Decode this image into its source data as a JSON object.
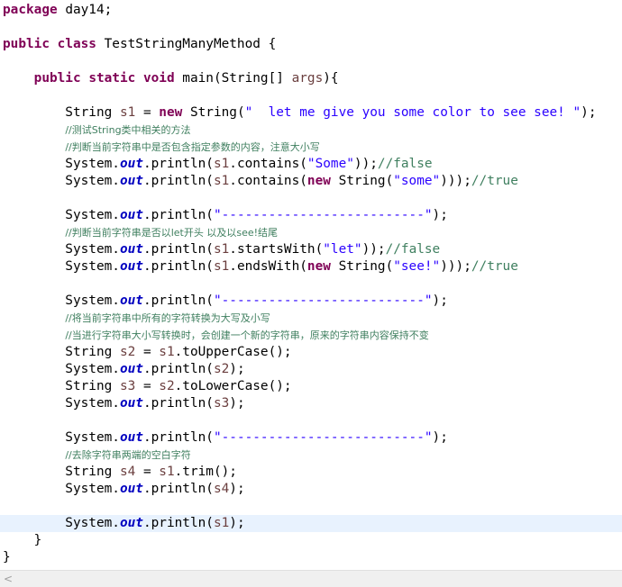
{
  "editor": {
    "current_line_index": 30,
    "colors": {
      "keyword": "#7f0055",
      "string": "#2a00ff",
      "comment": "#3f7f5f",
      "static_field": "#0000c0",
      "local_variable": "#6a3e3e",
      "current_line": "#e8f2fe"
    },
    "lines": [
      [
        {
          "t": "kw",
          "v": "package"
        },
        {
          "t": "pl",
          "v": " day14;"
        }
      ],
      [],
      [
        {
          "t": "kw",
          "v": "public"
        },
        {
          "t": "pl",
          "v": " "
        },
        {
          "t": "kw",
          "v": "class"
        },
        {
          "t": "pl",
          "v": " TestStringManyMethod {"
        }
      ],
      [],
      [
        {
          "t": "pl",
          "v": "    "
        },
        {
          "t": "kw",
          "v": "public"
        },
        {
          "t": "pl",
          "v": " "
        },
        {
          "t": "kw",
          "v": "static"
        },
        {
          "t": "pl",
          "v": " "
        },
        {
          "t": "kw",
          "v": "void"
        },
        {
          "t": "pl",
          "v": " main(String[] "
        },
        {
          "t": "loc",
          "v": "args"
        },
        {
          "t": "pl",
          "v": "){"
        }
      ],
      [],
      [
        {
          "t": "pl",
          "v": "        String "
        },
        {
          "t": "loc",
          "v": "s1"
        },
        {
          "t": "pl",
          "v": " = "
        },
        {
          "t": "kw",
          "v": "new"
        },
        {
          "t": "pl",
          "v": " String("
        },
        {
          "t": "str",
          "v": "\"  let me give you some color to see see! \""
        },
        {
          "t": "pl",
          "v": ");"
        }
      ],
      [
        {
          "t": "pl",
          "v": "        "
        },
        {
          "t": "cmt",
          "v": "//测试String类中相关的方法"
        }
      ],
      [
        {
          "t": "pl",
          "v": "        "
        },
        {
          "t": "cmt",
          "v": "//判断当前字符串中是否包含指定参数的内容，注意大小写"
        }
      ],
      [
        {
          "t": "pl",
          "v": "        System."
        },
        {
          "t": "fld",
          "v": "out"
        },
        {
          "t": "pl",
          "v": ".println("
        },
        {
          "t": "loc",
          "v": "s1"
        },
        {
          "t": "pl",
          "v": ".contains("
        },
        {
          "t": "str",
          "v": "\"Some\""
        },
        {
          "t": "pl",
          "v": "));"
        },
        {
          "t": "cmt",
          "v": "//false"
        }
      ],
      [
        {
          "t": "pl",
          "v": "        System."
        },
        {
          "t": "fld",
          "v": "out"
        },
        {
          "t": "pl",
          "v": ".println("
        },
        {
          "t": "loc",
          "v": "s1"
        },
        {
          "t": "pl",
          "v": ".contains("
        },
        {
          "t": "kw",
          "v": "new"
        },
        {
          "t": "pl",
          "v": " String("
        },
        {
          "t": "str",
          "v": "\"some\""
        },
        {
          "t": "pl",
          "v": ")));"
        },
        {
          "t": "cmt",
          "v": "//true"
        }
      ],
      [],
      [
        {
          "t": "pl",
          "v": "        System."
        },
        {
          "t": "fld",
          "v": "out"
        },
        {
          "t": "pl",
          "v": ".println("
        },
        {
          "t": "str",
          "v": "\"--------------------------\""
        },
        {
          "t": "pl",
          "v": ");"
        }
      ],
      [
        {
          "t": "pl",
          "v": "        "
        },
        {
          "t": "cmt",
          "v": "//判断当前字符串是否以let开头 以及以see!结尾"
        }
      ],
      [
        {
          "t": "pl",
          "v": "        System."
        },
        {
          "t": "fld",
          "v": "out"
        },
        {
          "t": "pl",
          "v": ".println("
        },
        {
          "t": "loc",
          "v": "s1"
        },
        {
          "t": "pl",
          "v": ".startsWith("
        },
        {
          "t": "str",
          "v": "\"let\""
        },
        {
          "t": "pl",
          "v": "));"
        },
        {
          "t": "cmt",
          "v": "//false"
        }
      ],
      [
        {
          "t": "pl",
          "v": "        System."
        },
        {
          "t": "fld",
          "v": "out"
        },
        {
          "t": "pl",
          "v": ".println("
        },
        {
          "t": "loc",
          "v": "s1"
        },
        {
          "t": "pl",
          "v": ".endsWith("
        },
        {
          "t": "kw",
          "v": "new"
        },
        {
          "t": "pl",
          "v": " String("
        },
        {
          "t": "str",
          "v": "\"see!\""
        },
        {
          "t": "pl",
          "v": ")));"
        },
        {
          "t": "cmt",
          "v": "//true"
        }
      ],
      [],
      [
        {
          "t": "pl",
          "v": "        System."
        },
        {
          "t": "fld",
          "v": "out"
        },
        {
          "t": "pl",
          "v": ".println("
        },
        {
          "t": "str",
          "v": "\"--------------------------\""
        },
        {
          "t": "pl",
          "v": ");"
        }
      ],
      [
        {
          "t": "pl",
          "v": "        "
        },
        {
          "t": "cmt",
          "v": "//将当前字符串中所有的字符转换为大写及小写"
        }
      ],
      [
        {
          "t": "pl",
          "v": "        "
        },
        {
          "t": "cmt",
          "v": "//当进行字符串大小写转换时，会创建一个新的字符串，原来的字符串内容保持不变"
        }
      ],
      [
        {
          "t": "pl",
          "v": "        String "
        },
        {
          "t": "loc",
          "v": "s2"
        },
        {
          "t": "pl",
          "v": " = "
        },
        {
          "t": "loc",
          "v": "s1"
        },
        {
          "t": "pl",
          "v": ".toUpperCase();"
        }
      ],
      [
        {
          "t": "pl",
          "v": "        System."
        },
        {
          "t": "fld",
          "v": "out"
        },
        {
          "t": "pl",
          "v": ".println("
        },
        {
          "t": "loc",
          "v": "s2"
        },
        {
          "t": "pl",
          "v": ");"
        }
      ],
      [
        {
          "t": "pl",
          "v": "        String "
        },
        {
          "t": "loc",
          "v": "s3"
        },
        {
          "t": "pl",
          "v": " = "
        },
        {
          "t": "loc",
          "v": "s2"
        },
        {
          "t": "pl",
          "v": ".toLowerCase();"
        }
      ],
      [
        {
          "t": "pl",
          "v": "        System."
        },
        {
          "t": "fld",
          "v": "out"
        },
        {
          "t": "pl",
          "v": ".println("
        },
        {
          "t": "loc",
          "v": "s3"
        },
        {
          "t": "pl",
          "v": ");"
        }
      ],
      [],
      [
        {
          "t": "pl",
          "v": "        System."
        },
        {
          "t": "fld",
          "v": "out"
        },
        {
          "t": "pl",
          "v": ".println("
        },
        {
          "t": "str",
          "v": "\"--------------------------\""
        },
        {
          "t": "pl",
          "v": ");"
        }
      ],
      [
        {
          "t": "pl",
          "v": "        "
        },
        {
          "t": "cmt",
          "v": "//去除字符串两端的空白字符"
        }
      ],
      [
        {
          "t": "pl",
          "v": "        String "
        },
        {
          "t": "loc",
          "v": "s4"
        },
        {
          "t": "pl",
          "v": " = "
        },
        {
          "t": "loc",
          "v": "s1"
        },
        {
          "t": "pl",
          "v": ".trim();"
        }
      ],
      [
        {
          "t": "pl",
          "v": "        System."
        },
        {
          "t": "fld",
          "v": "out"
        },
        {
          "t": "pl",
          "v": ".println("
        },
        {
          "t": "loc",
          "v": "s4"
        },
        {
          "t": "pl",
          "v": ");"
        }
      ],
      [],
      [
        {
          "t": "pl",
          "v": "        System."
        },
        {
          "t": "fld",
          "v": "out"
        },
        {
          "t": "pl",
          "v": ".println("
        },
        {
          "t": "loc",
          "v": "s1"
        },
        {
          "t": "pl",
          "v": ");"
        }
      ],
      [
        {
          "t": "pl",
          "v": "    }"
        }
      ],
      [
        {
          "t": "pl",
          "v": "}"
        }
      ]
    ]
  },
  "scrollbar": {
    "left_arrow_icon": "chevron-left-icon",
    "left_arrow_glyph": "<"
  }
}
